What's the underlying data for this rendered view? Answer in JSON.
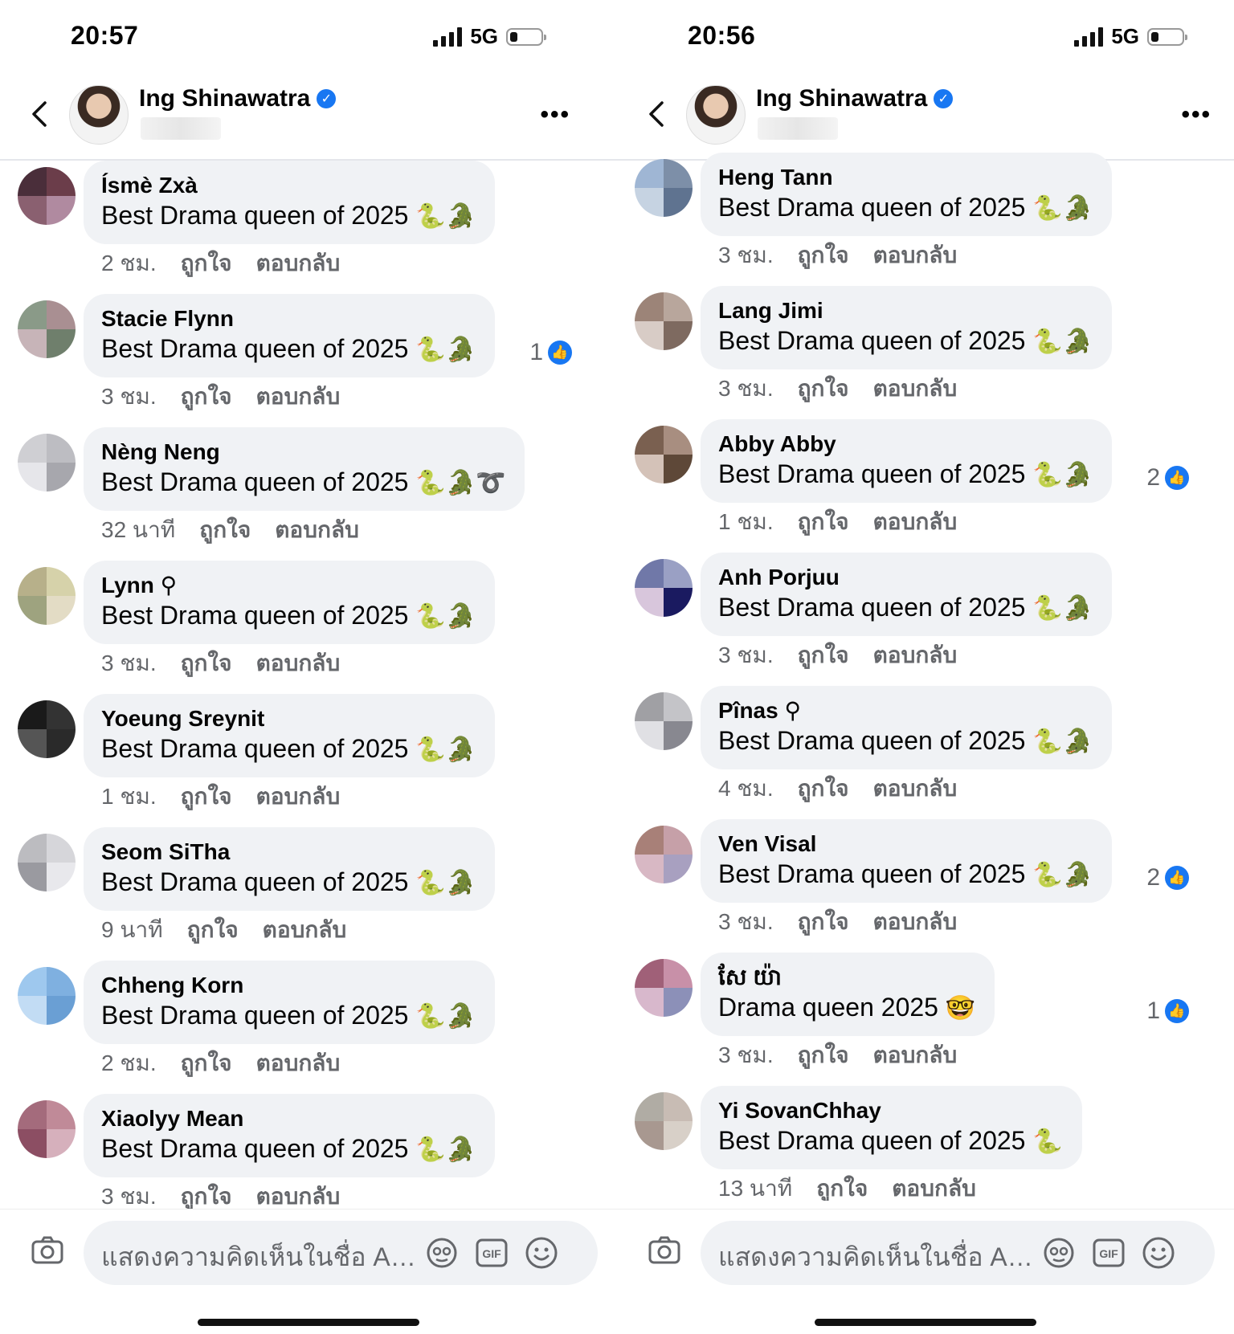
{
  "left": {
    "status": {
      "time": "20:57",
      "network": "5G"
    },
    "header": {
      "name": "Ing Shinawatra",
      "verified": "✓"
    },
    "comments": [
      {
        "name": "Ísmè Zxà",
        "text": "Best Drama queen of 2025",
        "emoji": "🐍🐊",
        "time": "2 ชม.",
        "like_label": "ถูกใจ",
        "reply_label": "ตอบกลับ",
        "likes": "",
        "avatar": [
          "#4a2e3a",
          "#6b3d4a",
          "#8a6070",
          "#b08aa0"
        ]
      },
      {
        "name": "Stacie Flynn",
        "text": "Best Drama queen of 2025",
        "emoji": "🐍🐊",
        "time": "3 ชม.",
        "like_label": "ถูกใจ",
        "reply_label": "ตอบกลับ",
        "likes": "1",
        "avatar": [
          "#8a9a88",
          "#a98f92",
          "#c7b4b8",
          "#6f7f6c"
        ]
      },
      {
        "name": "Nèng Neng",
        "text": "Best Drama queen of 2025",
        "emoji": "🐍🐊➰",
        "time": "32 นาที",
        "like_label": "ถูกใจ",
        "reply_label": "ตอบกลับ",
        "likes": "",
        "avatar": [
          "#cfcfd3",
          "#bdbdc2",
          "#e6e6ea",
          "#a7a7ad"
        ]
      },
      {
        "name": "Lynn ⚲",
        "text": "Best Drama queen of 2025",
        "emoji": "🐍🐊",
        "time": "3 ชม.",
        "like_label": "ถูกใจ",
        "reply_label": "ตอบกลับ",
        "likes": "",
        "avatar": [
          "#b7b08a",
          "#d6d2aa",
          "#9ea37f",
          "#e3dcc5"
        ]
      },
      {
        "name": "Yoeung Sreynit",
        "text": "Best Drama queen of 2025",
        "emoji": "🐍🐊",
        "time": "1 ชม.",
        "like_label": "ถูกใจ",
        "reply_label": "ตอบกลับ",
        "likes": "",
        "avatar": [
          "#1a1a1a",
          "#333333",
          "#555555",
          "#2a2a2a"
        ]
      },
      {
        "name": "Seom SiTha",
        "text": "Best Drama queen of 2025",
        "emoji": "🐍🐊",
        "time": "9 นาที",
        "like_label": "ถูกใจ",
        "reply_label": "ตอบกลับ",
        "likes": "",
        "avatar": [
          "#bcbcc0",
          "#d6d6da",
          "#9a9aa0",
          "#e8e8ec"
        ]
      },
      {
        "name": "Chheng Korn",
        "text": "Best Drama queen of 2025",
        "emoji": "🐍🐊",
        "time": "2 ชม.",
        "like_label": "ถูกใจ",
        "reply_label": "ตอบกลับ",
        "likes": "",
        "avatar": [
          "#9ec8ee",
          "#7fb0e0",
          "#c2dcf4",
          "#6a9fd4"
        ]
      },
      {
        "name": "Xiaolyy Mean",
        "text": "Best Drama queen of 2025",
        "emoji": "🐍🐊",
        "time": "3 ชม.",
        "like_label": "ถูกใจ",
        "reply_label": "ตอบกลับ",
        "likes": "",
        "avatar": [
          "#a46b7c",
          "#c08a98",
          "#8c4e63",
          "#d6b0bc"
        ]
      }
    ],
    "input": {
      "placeholder": "แสดงความคิดเห็นในชื่อ An..."
    }
  },
  "right": {
    "status": {
      "time": "20:56",
      "network": "5G"
    },
    "header": {
      "name": "Ing Shinawatra",
      "verified": "✓"
    },
    "comments": [
      {
        "name": "Heng Tann",
        "text": "Best Drama queen of 2025",
        "emoji": "🐍🐊",
        "time": "3 ชม.",
        "like_label": "ถูกใจ",
        "reply_label": "ตอบกลับ",
        "likes": "",
        "avatar": [
          "#9fb6d4",
          "#7d8fa8",
          "#c6d3e2",
          "#5f7390"
        ]
      },
      {
        "name": "Lang Jimi",
        "text": "Best Drama queen of 2025",
        "emoji": "🐍🐊",
        "time": "3 ชม.",
        "like_label": "ถูกใจ",
        "reply_label": "ตอบกลับ",
        "likes": "",
        "avatar": [
          "#9c8478",
          "#b8a69c",
          "#d8ccc6",
          "#7e6a60"
        ]
      },
      {
        "name": "Abby Abby",
        "text": "Best Drama queen of 2025",
        "emoji": "🐍🐊",
        "time": "1 ชม.",
        "like_label": "ถูกใจ",
        "reply_label": "ตอบกลับ",
        "likes": "2",
        "avatar": [
          "#7a6050",
          "#a88e80",
          "#d4c2b8",
          "#5e4838"
        ]
      },
      {
        "name": "Anh Porjuu",
        "text": "Best Drama queen of 2025",
        "emoji": "🐍🐊",
        "time": "3 ชม.",
        "like_label": "ถูกใจ",
        "reply_label": "ตอบกลับ",
        "likes": "",
        "avatar": [
          "#7078a8",
          "#9aa0c4",
          "#d8c6dc",
          "#1a1a60"
        ]
      },
      {
        "name": "Pînas ⚲",
        "text": "Best Drama queen of 2025",
        "emoji": "🐍🐊",
        "time": "4 ชม.",
        "like_label": "ถูกใจ",
        "reply_label": "ตอบกลับ",
        "likes": "",
        "avatar": [
          "#a0a0a4",
          "#c4c4c8",
          "#e0e0e4",
          "#888890"
        ]
      },
      {
        "name": "Ven Visal",
        "text": "Best Drama queen of 2025",
        "emoji": "🐍🐊",
        "time": "3 ชม.",
        "like_label": "ถูกใจ",
        "reply_label": "ตอบกลับ",
        "likes": "2",
        "avatar": [
          "#a88078",
          "#c6a0a8",
          "#d8b8c4",
          "#a8a0c0"
        ]
      },
      {
        "name": "សែ យ៉ា",
        "text": "Drama queen 2025",
        "emoji": "🤓",
        "time": "3 ชม.",
        "like_label": "ถูกใจ",
        "reply_label": "ตอบกลับ",
        "likes": "1",
        "avatar": [
          "#a06078",
          "#c890a8",
          "#d8b8cc",
          "#8c90b8"
        ]
      },
      {
        "name": "Yi SovanChhay",
        "text": "Best Drama queen of 2025",
        "emoji": "🐍",
        "time": "13 นาที",
        "like_label": "ถูกใจ",
        "reply_label": "ตอบกลับ",
        "likes": "",
        "avatar": [
          "#b0aca4",
          "#c8bcb4",
          "#a89890",
          "#d8d0c8"
        ]
      }
    ],
    "input": {
      "placeholder": "แสดงความคิดเห็นในชื่อ An..."
    }
  }
}
